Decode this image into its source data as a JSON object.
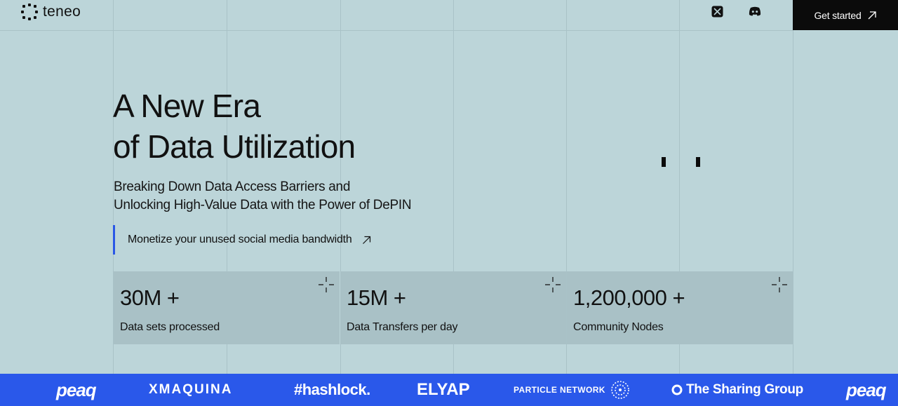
{
  "header": {
    "brand": "teneo",
    "social_icons": [
      "x-icon",
      "discord-icon"
    ],
    "cta_label": "Get started"
  },
  "hero": {
    "headline_line1": "A New Era",
    "headline_line2": "of Data Utilization",
    "subhead_line1": "Breaking Down Data Access Barriers and",
    "subhead_line2": "Unlocking High-Value Data with the Power of DePIN",
    "monetize_label": "Monetize your unused social media bandwidth"
  },
  "stats": [
    {
      "value": "30M +",
      "label": "Data sets processed"
    },
    {
      "value": "15M +",
      "label": "Data Transfers per day"
    },
    {
      "value": "1,200,000 +",
      "label": "Community Nodes"
    }
  ],
  "partners": [
    "peaq",
    "XMAQUINA",
    "#hashlock.",
    "ELYAP",
    "PARTICLE NETWORK",
    "The Sharing Group",
    "peaq"
  ],
  "colors": {
    "background": "#bcd5d9",
    "stat_panel": "#a9c1c6",
    "accent_blue": "#2a58ea",
    "cta_black": "#0b0b0b"
  }
}
